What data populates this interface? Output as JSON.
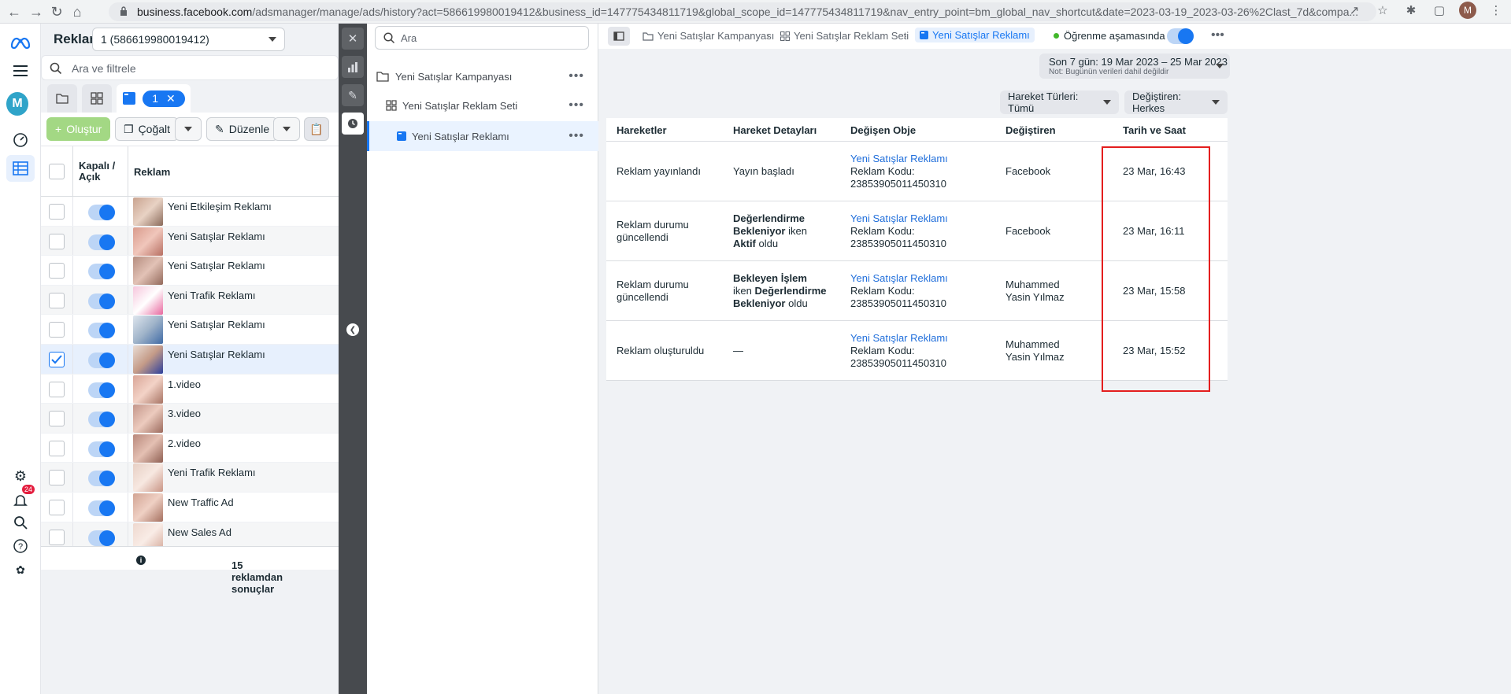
{
  "browser": {
    "url_domain": "business.facebook.com",
    "url_rest": "/adsmanager/manage/ads/history?act=586619980019412&business_id=147775434811719&global_scope_id=147775434811719&nav_entry_point=bm_global_nav_shortcut&date=2023-03-19_2023-03-26%2Clast_7d&compa...",
    "profile_initial": "M"
  },
  "rail": {
    "avatar": "M",
    "notif_count": "24"
  },
  "left": {
    "title": "Reklam",
    "account": "1 (586619980019412)",
    "search_placeholder": "Ara ve filtrele",
    "tab_pill": "1",
    "create_label": "Oluştur",
    "duplicate_label": "Çoğalt",
    "edit_label": "Düzenle",
    "col_toggle": "Kapalı / Açık",
    "col_ad": "Reklam",
    "rows": [
      {
        "name": "Yeni Etkileşim Reklamı"
      },
      {
        "name": "Yeni Satışlar Reklamı"
      },
      {
        "name": "Yeni Satışlar Reklamı"
      },
      {
        "name": "Yeni Trafik Reklamı"
      },
      {
        "name": "Yeni Satışlar Reklamı"
      },
      {
        "name": "Yeni Satışlar Reklamı"
      },
      {
        "name": "1.video"
      },
      {
        "name": "3.video"
      },
      {
        "name": "2.video"
      },
      {
        "name": "Yeni Trafik Reklamı"
      },
      {
        "name": "New Traffic Ad"
      },
      {
        "name": "New Sales Ad"
      }
    ],
    "footer": "15 reklamdan sonuçlar"
  },
  "tree": {
    "search_placeholder": "Ara",
    "campaign": "Yeni Satışlar Kampanyası",
    "adset": "Yeni Satışlar Reklam Seti",
    "ad": "Yeni Satışlar Reklamı"
  },
  "main": {
    "crumb_campaign": "Yeni Satışlar Kampanyası",
    "crumb_adset": "Yeni Satışlar Reklam Seti",
    "crumb_ad": "Yeni Satışlar Reklamı",
    "learning": "Öğrenme aşamasında",
    "date_range": "Son 7 gün: 19 Mar 2023 – 25 Mar 2023",
    "date_note": "Not: Bugünün verileri dahil değildir",
    "filter_types": "Hareket Türleri: Tümü",
    "filter_changer": "Değiştiren: Herkes",
    "headers": [
      "Hareketler",
      "Hareket Detayları",
      "Değişen Obje",
      "Değiştiren",
      "Tarih ve Saat"
    ],
    "rows": [
      {
        "action": "Reklam yayınlandı",
        "obj": "Yeni Satışlar Reklamı",
        "code_label": "Reklam Kodu:",
        "code": "23853905011450310",
        "by": "Facebook",
        "date": "23 Mar, 16:43"
      },
      {
        "action": "Reklam durumu güncellendi",
        "obj": "Yeni Satışlar Reklamı",
        "code_label": "Reklam Kodu:",
        "code": "23853905011450310",
        "by": "Facebook",
        "date": "23 Mar, 16:11"
      },
      {
        "action": "Reklam durumu güncellendi",
        "obj": "Yeni Satışlar Reklamı",
        "code_label": "Reklam Kodu:",
        "code": "23853905011450310",
        "by": "Muhammed Yasin Yılmaz",
        "date": "23 Mar, 15:58"
      },
      {
        "action": "Reklam oluşturuldu",
        "obj": "Yeni Satışlar Reklamı",
        "code_label": "Reklam Kodu:",
        "code": "23853905011450310",
        "by": "Muhammed Yasin Yılmaz",
        "date": "23 Mar, 15:52"
      }
    ],
    "detail1": "Yayın başladı",
    "detail2": {
      "a": "Değerlendirme Bekleniyor",
      "b": " iken ",
      "c": "Aktif",
      "d": " oldu"
    },
    "detail3": {
      "a": "Bekleyen İşlem",
      "b": " iken ",
      "c": "Değerlendirme Bekleniyor",
      "d": " oldu"
    },
    "detail4": "—"
  }
}
